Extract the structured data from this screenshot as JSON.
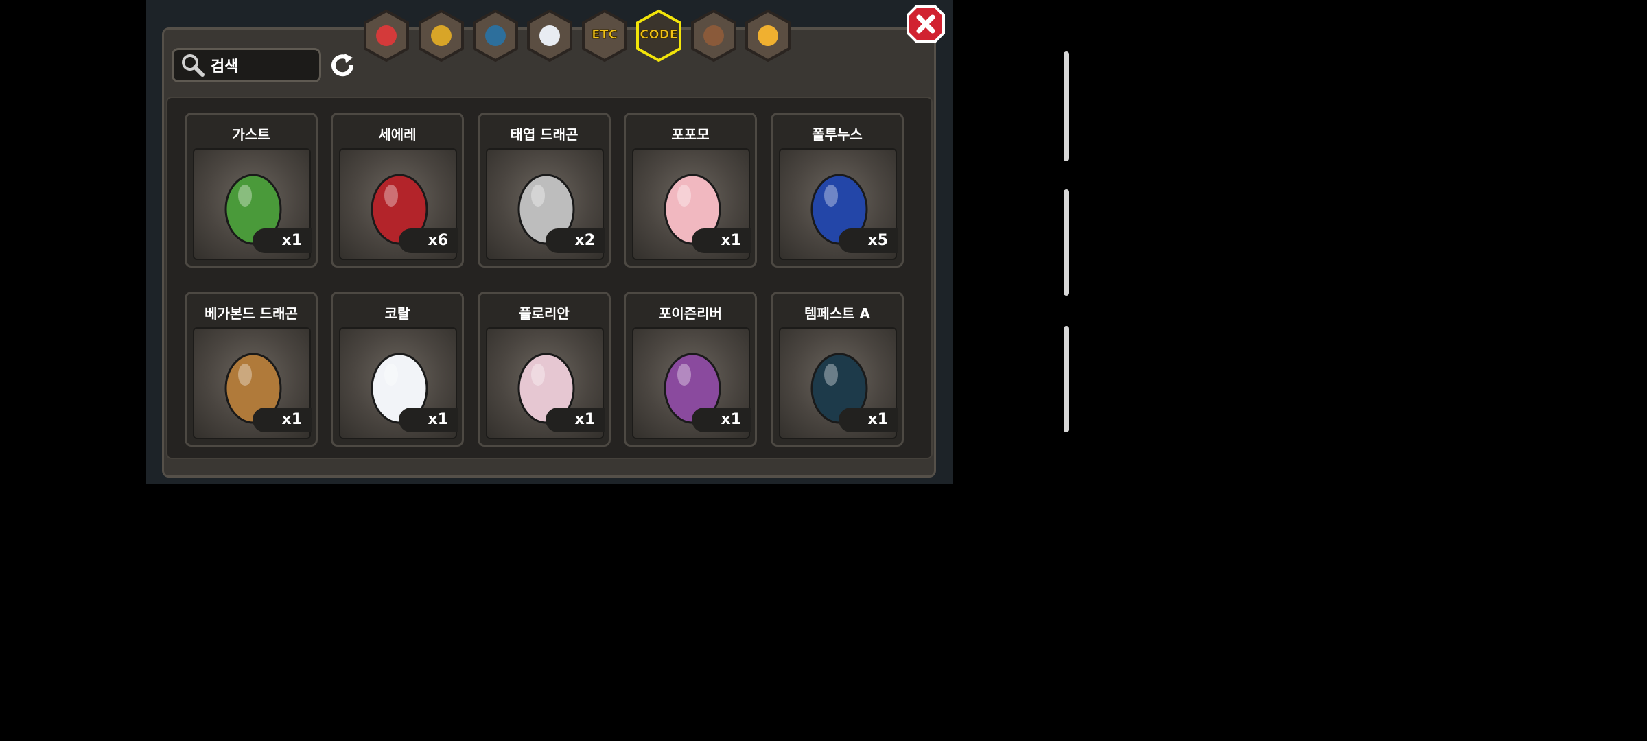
{
  "search": {
    "placeholder": "검색",
    "icon": "magnifier-icon"
  },
  "tabs": [
    {
      "icon": "fruit-icon",
      "label": ""
    },
    {
      "icon": "gold-nugget-icon",
      "label": ""
    },
    {
      "icon": "blue-scale-icon",
      "label": ""
    },
    {
      "icon": "egg-icon",
      "label": ""
    },
    {
      "icon": "etc-icon",
      "label": "ETC"
    },
    {
      "icon": "code-icon",
      "label": "CODE",
      "selected": true
    },
    {
      "icon": "werewolf-icon",
      "label": ""
    },
    {
      "icon": "cat-mask-icon",
      "label": ""
    }
  ],
  "items": [
    {
      "name": "가스트",
      "count": "x1",
      "color": "#4a9a3a"
    },
    {
      "name": "세에레",
      "count": "x6",
      "color": "#b3242a"
    },
    {
      "name": "태엽 드래곤",
      "count": "x2",
      "color": "#bdbdbd"
    },
    {
      "name": "포포모",
      "count": "x1",
      "color": "#f1b8c0"
    },
    {
      "name": "폴투누스",
      "count": "x5",
      "color": "#2346a8"
    },
    {
      "name": "베가본드 드래곤",
      "count": "x1",
      "color": "#b07a3a"
    },
    {
      "name": "코랄",
      "count": "x1",
      "color": "#f2f4f8"
    },
    {
      "name": "플로리안",
      "count": "x1",
      "color": "#e6c7d2"
    },
    {
      "name": "포이즌리버",
      "count": "x1",
      "color": "#8a4a9e"
    },
    {
      "name": "템페스트 A",
      "count": "x1",
      "color": "#1d3a4a"
    }
  ],
  "colors": {
    "accent": "#f2e40a",
    "tab": "#5b4e42"
  }
}
